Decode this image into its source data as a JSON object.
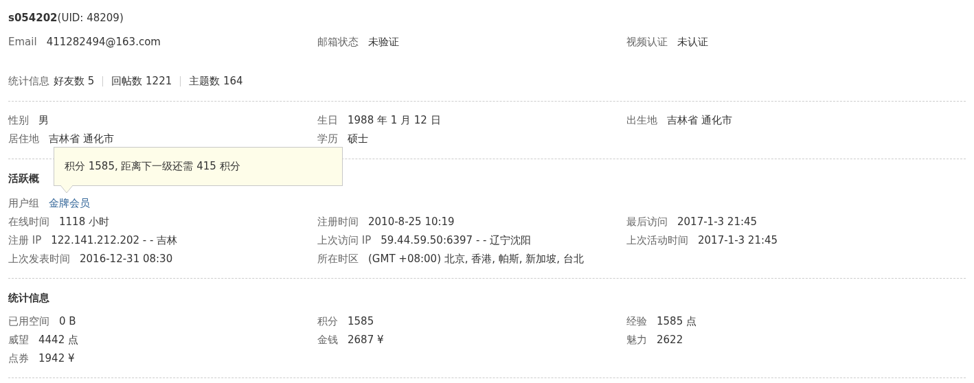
{
  "user": {
    "name": "s054202",
    "uid": "(UID: 48209)"
  },
  "contact": [
    {
      "label": "Email",
      "value": "411282494@163.com"
    },
    {
      "label": "邮箱状态",
      "value": "未验证"
    },
    {
      "label": "视频认证",
      "value": "未认证"
    }
  ],
  "summary": {
    "label": "统计信息",
    "items": [
      {
        "label": "好友数",
        "value": "5"
      },
      {
        "label": "回帖数",
        "value": "1221"
      },
      {
        "label": "主题数",
        "value": "164"
      }
    ]
  },
  "profile": [
    {
      "label": "性别",
      "value": "男"
    },
    {
      "label": "生日",
      "value": "1988 年 1 月 12 日"
    },
    {
      "label": "出生地",
      "value": "吉林省 通化市"
    },
    {
      "label": "居住地",
      "value": "吉林省 通化市"
    },
    {
      "label": "学历",
      "value": "硕士"
    }
  ],
  "activity": {
    "heading": "活跃概",
    "tooltip": "积分 1585, 距离下一级还需 415 积分",
    "group": {
      "label": "用户组",
      "value": "金牌会员"
    },
    "fields": [
      {
        "label": "在线时间",
        "value": "1118 小时"
      },
      {
        "label": "注册时间",
        "value": "2010-8-25 10:19"
      },
      {
        "label": "最后访问",
        "value": "2017-1-3 21:45"
      },
      {
        "label": "注册 IP",
        "value": "122.141.212.202 - - 吉林"
      },
      {
        "label": "上次访问 IP",
        "value": "59.44.59.50:6397 - - 辽宁沈阳"
      },
      {
        "label": "上次活动时间",
        "value": "2017-1-3 21:45"
      },
      {
        "label": "上次发表时间",
        "value": "2016-12-31 08:30"
      },
      {
        "label": "所在时区",
        "value": "(GMT +08:00) 北京, 香港, 帕斯, 新加坡, 台北"
      }
    ]
  },
  "stats": {
    "heading": "统计信息",
    "fields": [
      {
        "label": "已用空间",
        "value": "0 B"
      },
      {
        "label": "积分",
        "value": "1585"
      },
      {
        "label": "经验",
        "value": "1585 点"
      },
      {
        "label": "威望",
        "value": "4442 点"
      },
      {
        "label": "金钱",
        "value": "2687 ¥"
      },
      {
        "label": "魅力",
        "value": "2622"
      },
      {
        "label": "点券",
        "value": "1942 ¥"
      }
    ]
  }
}
